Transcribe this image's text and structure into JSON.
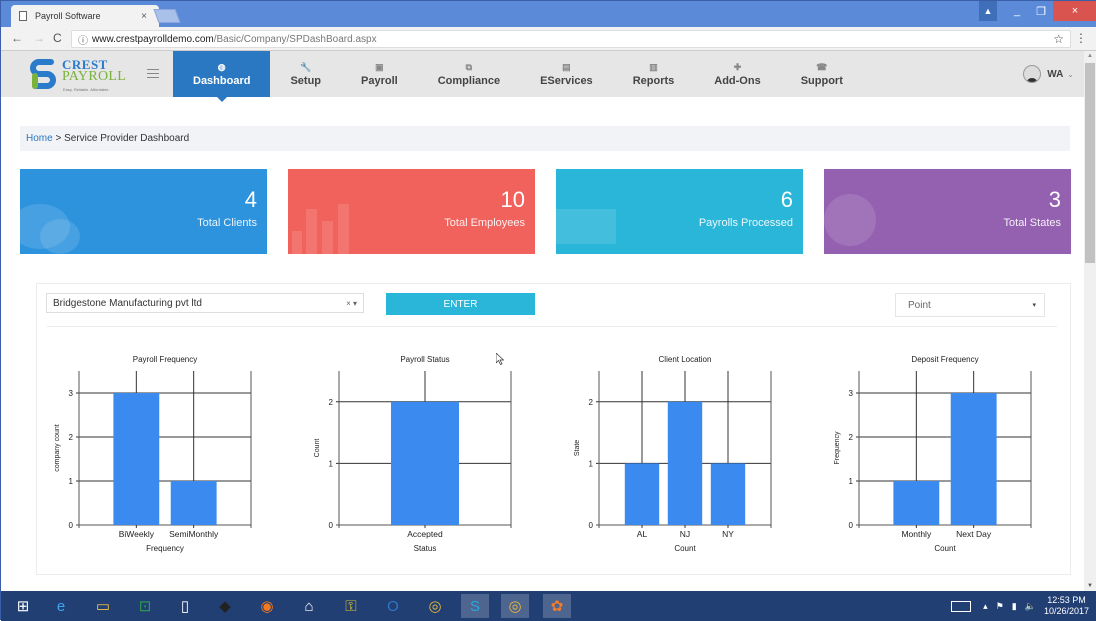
{
  "browser": {
    "tab_title": "Payroll Software",
    "tab_close": "×",
    "url_domain": "www.crestpayrolldemo.com",
    "url_path": "/Basic/Company/SPDashBoard.aspx",
    "info_icon": "ⓘ",
    "back": "←",
    "forward": "→",
    "reload": "C",
    "star": "☆",
    "menu": "⋮"
  },
  "window_controls": {
    "user": "▲",
    "minimize": "_",
    "maximize": "❐",
    "close": "×"
  },
  "header": {
    "logo_line1": "CREST",
    "logo_line2": "PAYROLL",
    "logo_tagline": "Easy. Reliable. Affordable.",
    "nav": [
      {
        "label": "Dashboard",
        "icon": "◍",
        "active": true
      },
      {
        "label": "Setup",
        "icon": "🔧"
      },
      {
        "label": "Payroll",
        "icon": "▣"
      },
      {
        "label": "Compliance",
        "icon": "⧉"
      },
      {
        "label": "EServices",
        "icon": "▤"
      },
      {
        "label": "Reports",
        "icon": "▥"
      },
      {
        "label": "Add-Ons",
        "icon": "✚"
      },
      {
        "label": "Support",
        "icon": "☎"
      }
    ],
    "user_initials": "WA",
    "user_chevron": "⌄"
  },
  "breadcrumb": {
    "home": "Home",
    "separator": " > ",
    "current": "Service Provider Dashboard"
  },
  "stats": [
    {
      "value": "4",
      "label": "Total Clients",
      "color": "#2d93dd"
    },
    {
      "value": "10",
      "label": "Total Employees",
      "color": "#f2625d"
    },
    {
      "value": "6",
      "label": "Payrolls Processed",
      "color": "#29b6d8"
    },
    {
      "value": "3",
      "label": "Total States",
      "color": "#9461b0"
    }
  ],
  "filters": {
    "company_select": "Bridgestone Manufacturing pvt ltd",
    "company_clear": "×",
    "company_arrow": "▾",
    "enter_label": "ENTER",
    "chart_type": "Point",
    "chart_type_arrow": "▾"
  },
  "chart_data": [
    {
      "type": "bar",
      "title": "Payroll Frequency",
      "xlabel": "Frequency",
      "ylabel": "company count",
      "categories": [
        "BiWeekly",
        "SemiMonthly"
      ],
      "values": [
        3,
        1
      ],
      "ylim": [
        0,
        3.5
      ],
      "yticks": [
        0,
        1,
        2,
        3
      ],
      "grid": true,
      "color": "#3a8af0"
    },
    {
      "type": "bar",
      "title": "Payroll Status",
      "xlabel": "Status",
      "ylabel": "Count",
      "categories": [
        "Accepted"
      ],
      "values": [
        2
      ],
      "ylim": [
        0,
        2.5
      ],
      "yticks": [
        0,
        1,
        2
      ],
      "grid": true,
      "color": "#3a8af0"
    },
    {
      "type": "bar",
      "title": "Client Location",
      "xlabel": "Count",
      "ylabel": "State",
      "categories": [
        "AL",
        "NJ",
        "NY"
      ],
      "values": [
        1,
        2,
        1
      ],
      "ylim": [
        0,
        2.5
      ],
      "yticks": [
        0,
        1,
        2
      ],
      "grid": true,
      "color": "#3a8af0"
    },
    {
      "type": "bar",
      "title": "Deposit Frequency",
      "xlabel": "Count",
      "ylabel": "Frequency",
      "categories": [
        "Monthly",
        "Next Day"
      ],
      "values": [
        1,
        3
      ],
      "ylim": [
        0,
        3.5
      ],
      "yticks": [
        0,
        1,
        2,
        3
      ],
      "grid": true,
      "color": "#3a8af0"
    }
  ],
  "taskbar": {
    "apps": [
      {
        "name": "start",
        "glyph": "⊞"
      },
      {
        "name": "internet-explorer",
        "glyph": "e"
      },
      {
        "name": "file-explorer",
        "glyph": "▭"
      },
      {
        "name": "store",
        "glyph": "⊡"
      },
      {
        "name": "document",
        "glyph": "▯"
      },
      {
        "name": "app-dark",
        "glyph": "◆"
      },
      {
        "name": "firefox",
        "glyph": "◉"
      },
      {
        "name": "home",
        "glyph": "⌂"
      },
      {
        "name": "lock-app",
        "glyph": "⚿"
      },
      {
        "name": "outlook",
        "glyph": "O"
      },
      {
        "name": "chrome",
        "glyph": "◎"
      },
      {
        "name": "skype",
        "glyph": "S"
      },
      {
        "name": "chrome-active",
        "glyph": "◎"
      },
      {
        "name": "flower-app",
        "glyph": "✿"
      }
    ],
    "time": "12:53 PM",
    "date": "10/26/2017",
    "tray_up": "▴",
    "tray_flag": "⚑",
    "tray_battery": "▮",
    "tray_volume": "🔈"
  }
}
